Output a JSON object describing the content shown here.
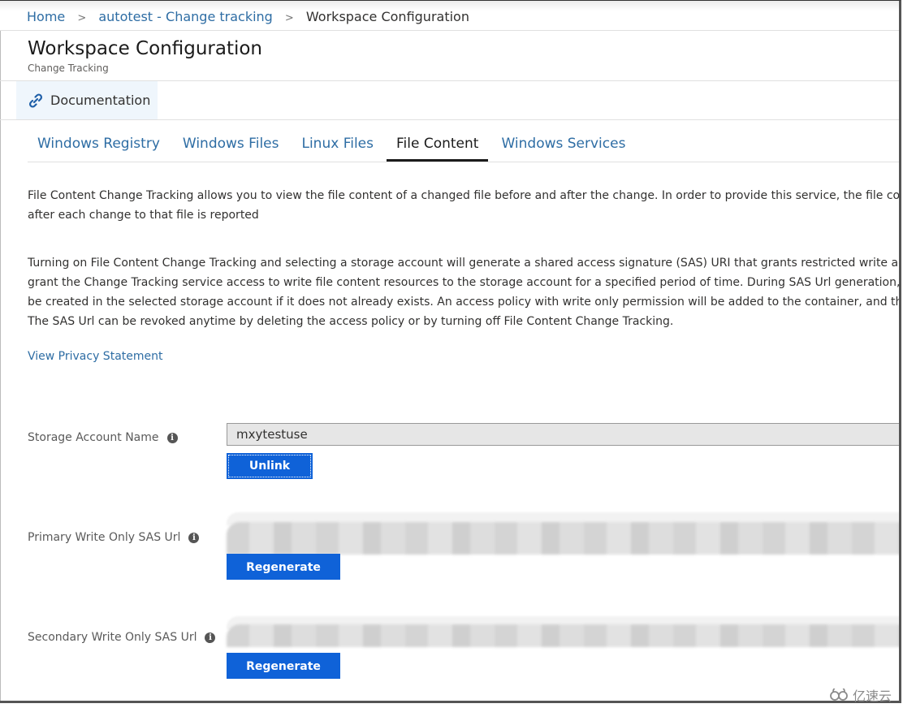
{
  "breadcrumb": {
    "items": [
      {
        "label": "Home"
      },
      {
        "label": "autotest - Change tracking"
      }
    ],
    "current": "Workspace Configuration",
    "separator": ">"
  },
  "header": {
    "title": "Workspace Configuration",
    "subtitle": "Change Tracking"
  },
  "commandbar": {
    "documentation_label": "Documentation",
    "documentation_icon": "link-icon"
  },
  "tabs": [
    {
      "label": "Windows Registry",
      "active": false
    },
    {
      "label": "Windows Files",
      "active": false
    },
    {
      "label": "Linux Files",
      "active": false
    },
    {
      "label": "File Content",
      "active": true
    },
    {
      "label": "Windows Services",
      "active": false
    }
  ],
  "content": {
    "intro_lines": [
      "File Content Change Tracking allows you to view the file content of a changed file before and after the change. In order to provide this service, the file co",
      "after each change to that file is reported"
    ],
    "sas_lines": [
      "Turning on File Content Change Tracking and selecting a storage account will generate a shared access signature (SAS) URI that grants restricted write ac",
      "grant the Change Tracking service access to write file content resources to the storage account for a specified period of time. During SAS Url generation,",
      "be created in the selected storage account if it does not already exists. An access policy with write only permission will be added to the container, and th",
      "The SAS Url can be revoked anytime by deleting the access policy or by turning off File Content Change Tracking."
    ],
    "privacy_link": "View Privacy Statement"
  },
  "form": {
    "storage_account": {
      "label": "Storage Account Name",
      "value": "mxytestuse",
      "button": "Unlink"
    },
    "primary_sas": {
      "label": "Primary Write Only SAS Url",
      "value": "",
      "button": "Regenerate"
    },
    "secondary_sas": {
      "label": "Secondary Write Only SAS Url",
      "value": "",
      "button": "Regenerate"
    }
  },
  "watermark": "亿速云",
  "colors": {
    "link": "#2e6da4",
    "primary_button": "#0f62d8",
    "command_hover": "#eff6fc"
  }
}
